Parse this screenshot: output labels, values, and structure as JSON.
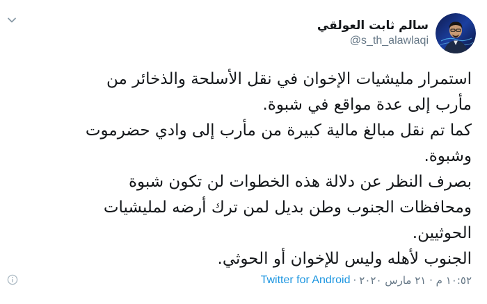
{
  "tweet": {
    "author": {
      "display_name": "سالم ثابت العولقي",
      "handle": "@s_th_alawlaqi",
      "avatar_icon": "profile-photo"
    },
    "lines": [
      "استمرار مليشيات الإخوان في نقل الأسلحة والذخائر من",
      "مأرب إلى عدة مواقع في شبوة.",
      "كما تم نقل مبالغ مالية كبيرة من مأرب إلى وادي حضرموت",
      "وشبوة.",
      "بصرف النظر عن دلالة هذه الخطوات لن تكون شبوة",
      "ومحافظات الجنوب وطن بديل لمن ترك أرضه لمليشيات",
      "الحوثيين.",
      "الجنوب لأهله وليس للإخوان أو الحوثي."
    ],
    "timestamp": "١٠:٥٢ م · ٢١ مارس ٢٠٢٠",
    "separator": "·",
    "source": "Twitter for Android",
    "more_icon": "chevron-down",
    "info_icon": "info-circle"
  },
  "colors": {
    "text": "#14171a",
    "muted": "#657786",
    "link": "#1b95e0",
    "background": "#ffffff"
  }
}
